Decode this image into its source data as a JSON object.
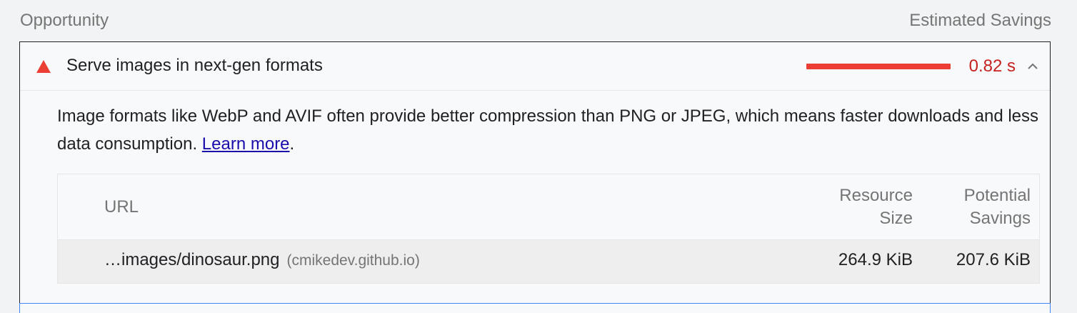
{
  "header": {
    "left_label": "Opportunity",
    "right_label": "Estimated Savings"
  },
  "audit": {
    "status_icon": "fail-triangle-icon",
    "status_color": "#eb3f35",
    "title": "Serve images in next-gen formats",
    "savings_value": "0.82 s",
    "savings_color": "#c5221f",
    "savings_bar_fraction": 1.0,
    "expanded": true,
    "toggle_icon": "chevron-up-icon",
    "description_text": "Image formats like WebP and AVIF often provide better compression than PNG or JPEG, which means faster downloads and less data consumption. ",
    "learn_more_label": "Learn more",
    "description_suffix": "."
  },
  "table": {
    "columns": {
      "url": "URL",
      "resource_size_line1": "Resource",
      "resource_size_line2": "Size",
      "potential_savings_line1": "Potential",
      "potential_savings_line2": "Savings"
    },
    "rows": [
      {
        "url": "…images/dinosaur.png",
        "host": "(cmikedev.github.io)",
        "resource_size": "264.9 KiB",
        "potential_savings": "207.6 KiB"
      }
    ]
  }
}
